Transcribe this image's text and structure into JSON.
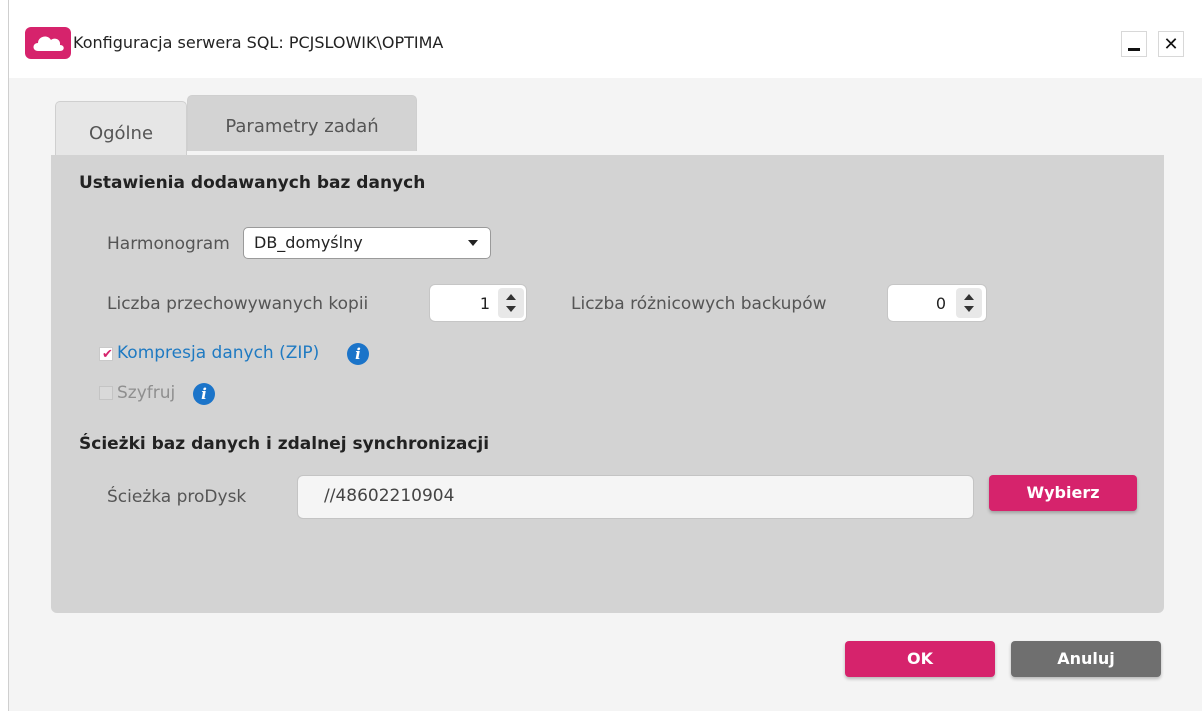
{
  "window": {
    "title": "Konfiguracja serwera SQL: PCJSLOWIK\\OPTIMA",
    "app_icon": "cloud-icon",
    "brand_color": "#d6236c"
  },
  "tabs": [
    {
      "label": "Ogólne",
      "active": false
    },
    {
      "label": "Parametry zadań",
      "active": true
    }
  ],
  "section_new_db": {
    "title": "Ustawienia dodawanych baz danych",
    "schedule_label": "Harmonogram",
    "schedule_value": "DB_domyślny",
    "copies_label": "Liczba przechowywanych kopii",
    "copies_value": "1",
    "diff_label": "Liczba różnicowych backupów",
    "diff_value": "0",
    "compress_label": "Kompresja danych (ZIP)",
    "compress_checked": true,
    "encrypt_label": "Szyfruj",
    "encrypt_checked": false,
    "encrypt_disabled": true
  },
  "section_paths": {
    "title": "Ścieżki baz danych i zdalnej synchronizacji",
    "prodysk_label": "Ścieżka proDysk",
    "prodysk_value": "//48602210904",
    "choose_label": "Wybierz"
  },
  "footer": {
    "ok_label": "OK",
    "cancel_label": "Anuluj"
  }
}
